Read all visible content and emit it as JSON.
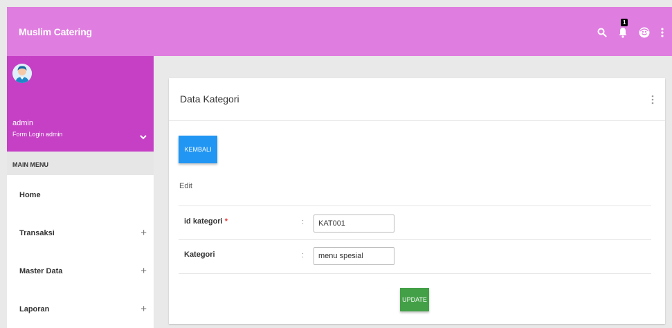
{
  "header": {
    "brand": "Muslim Catering",
    "notification_count": "1",
    "icons": [
      "search-icon",
      "bell-icon",
      "user-circle-icon",
      "more-vertical-icon"
    ]
  },
  "sidebar": {
    "user_name": "admin",
    "user_subtitle": "Form Login admin",
    "menu_header": "MAIN MENU",
    "items": [
      {
        "label": "Home",
        "expandable": false
      },
      {
        "label": "Transaksi",
        "expandable": true,
        "toggle": "+"
      },
      {
        "label": "Master Data",
        "expandable": true,
        "toggle": "+"
      },
      {
        "label": "Laporan",
        "expandable": true,
        "toggle": "+"
      }
    ]
  },
  "card": {
    "title": "Data Kategori",
    "back_button": "KEMBALI",
    "section_label": "Edit",
    "fields": [
      {
        "label": "id kategori",
        "required_mark": "*",
        "separator": ":",
        "value": "KAT001"
      },
      {
        "label": "Kategori",
        "separator": ":",
        "value": "menu spesial"
      }
    ],
    "submit_button": "UPDATE"
  },
  "colors": {
    "topbar": "#e07de0",
    "user_panel": "#c540c5",
    "primary_button": "#2196f3",
    "submit_button": "#43a047",
    "required": "#e53935"
  }
}
